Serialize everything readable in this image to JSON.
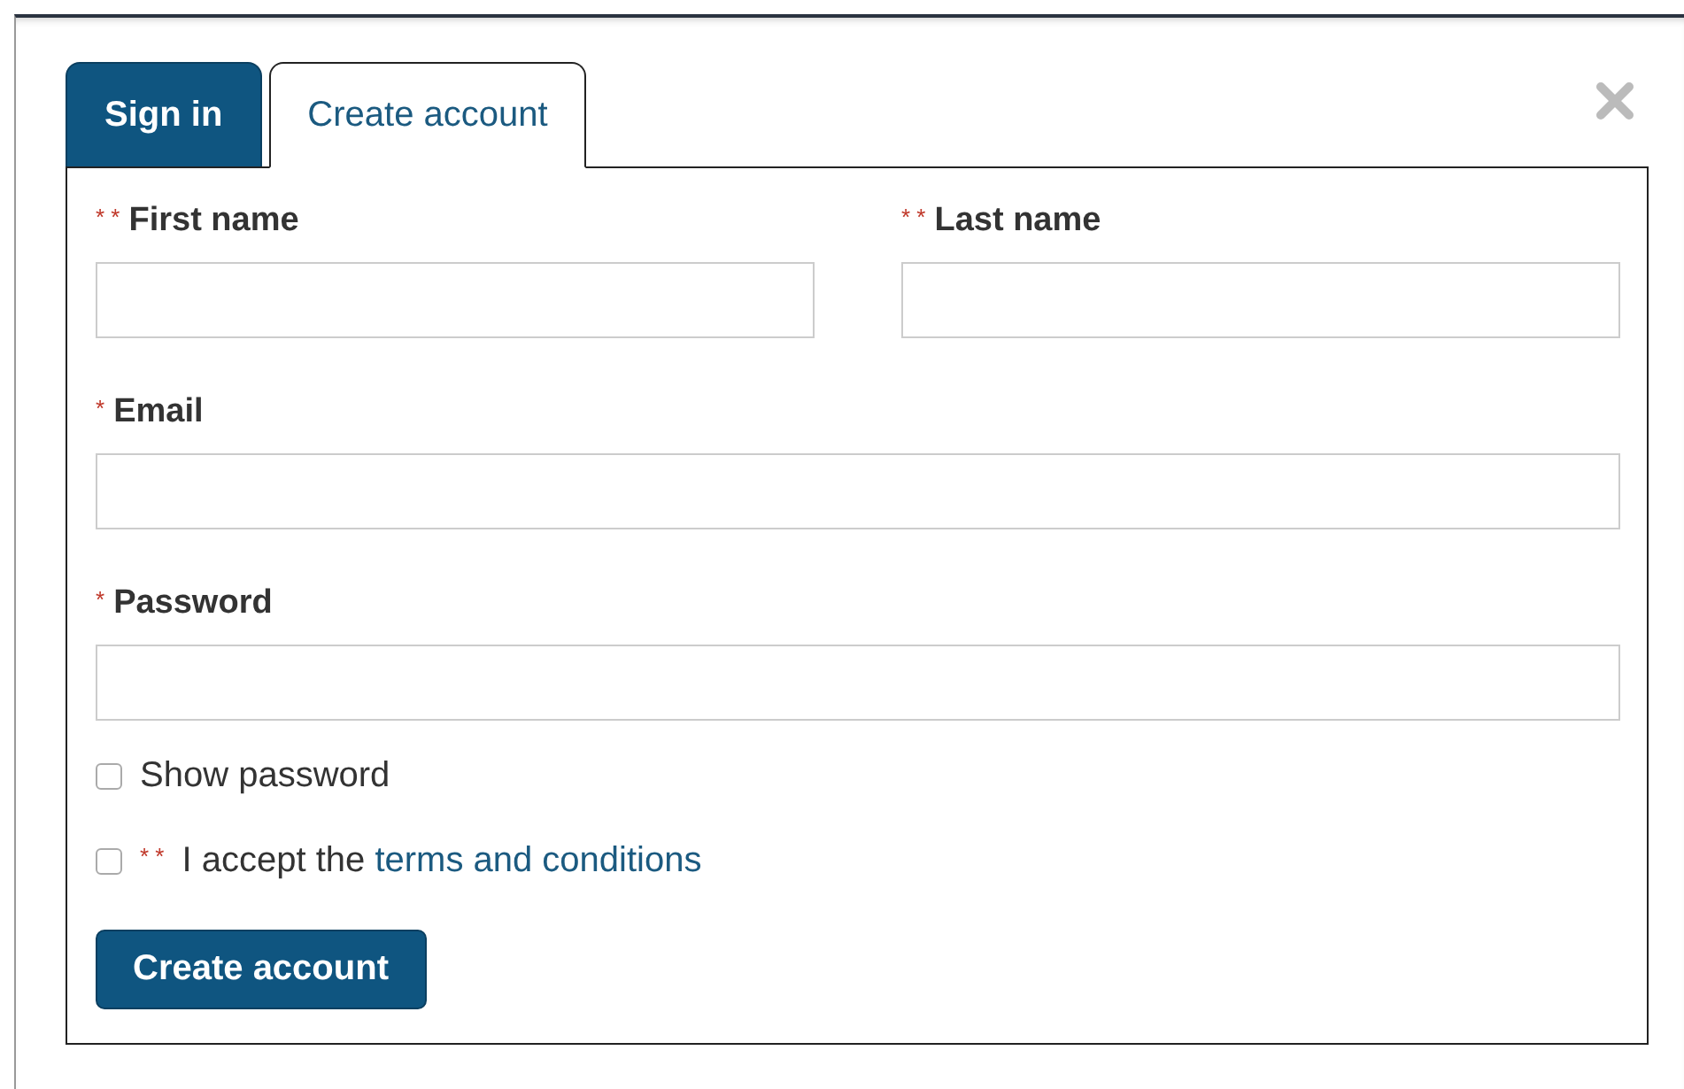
{
  "tabs": [
    {
      "label": "Sign in",
      "selected": false
    },
    {
      "label": "Create account",
      "selected": true
    }
  ],
  "fields": [
    {
      "marker": "* *",
      "label": "First name",
      "kind": "half"
    },
    {
      "marker": "* *",
      "label": "Last name",
      "kind": "half"
    },
    {
      "marker": "*",
      "label": "Email",
      "kind": "full"
    },
    {
      "marker": "*",
      "label": "Password",
      "kind": "full"
    }
  ],
  "checkboxes": [
    {
      "label": "Show password",
      "checked": false
    },
    {
      "marker": "* *",
      "label": "I accept the ",
      "link": "terms and conditions",
      "checked": false
    }
  ],
  "submit": {
    "label": "Create account"
  }
}
